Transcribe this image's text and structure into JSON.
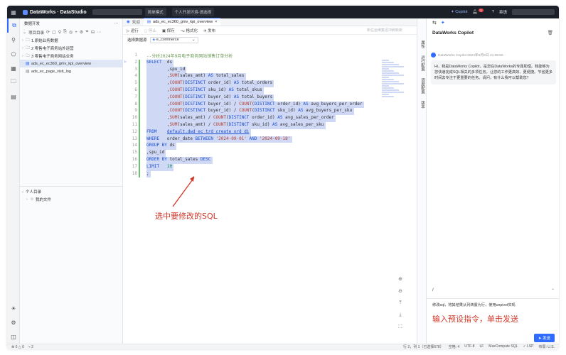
{
  "topbar": {
    "app_title": "DataWorks · DataStudio",
    "mode_pill": "简单模式",
    "env_label": "个人开发环境-请选择",
    "copilot_label": "Copilot",
    "notif_count": "1",
    "user_label": "英语"
  },
  "explorer": {
    "header": "数据开发",
    "section_title": "项目目录",
    "folders": [
      {
        "label": "1.原始业务数据"
      },
      {
        "label": "2 零售电子商务站外运营"
      },
      {
        "label": "3 零售电子商务网站业务"
      }
    ],
    "files": [
      {
        "label": "ads_ec_ec360_gmv_kpi_overview",
        "selected": true
      },
      {
        "label": "ads_ec_page_visit_log",
        "selected": false
      }
    ],
    "personal_title": "个人目录",
    "personal_folder": "我的文件"
  },
  "tabs": [
    {
      "label": "欢迎",
      "active": false
    },
    {
      "label": "ads_ec_ec360_gmv_kpi_overview",
      "active": true
    }
  ],
  "actions": {
    "run": "运行",
    "stop": "停止",
    "save": "保存",
    "format": "格式化",
    "publish": "发布",
    "right_hint": "新任运维集逗冲刷新新"
  },
  "datasource": {
    "label": "选择数据源",
    "value": "e_commerce"
  },
  "code_lines": [
    {
      "n": "1",
      "html": "<span class='cm'>--分析2024年9月电子商务网站销售订单分析</span>"
    },
    {
      "n": "2",
      "html": "<span class='kw'>SELECT</span>  ds"
    },
    {
      "n": "3",
      "html": "        ,spu_id"
    },
    {
      "n": "4",
      "html": "        ,<span class='fn'>SUM</span>(sales_amt) <span class='kw'>AS</span> total_sales"
    },
    {
      "n": "5",
      "html": "        ,<span class='fn'>COUNT</span>(<span class='kw'>DISTINCT</span> order_id) <span class='kw'>AS</span> total_orders"
    },
    {
      "n": "6",
      "html": "        ,<span class='fn'>COUNT</span>(<span class='kw'>DISTINCT</span> sku_id) <span class='kw'>AS</span> total_skus"
    },
    {
      "n": "7",
      "html": "        ,<span class='fn'>COUNT</span>(<span class='kw'>DISTINCT</span> buyer_id) <span class='kw'>AS</span> total_buyers"
    },
    {
      "n": "8",
      "html": "        ,<span class='fn'>COUNT</span>(<span class='kw'>DISTINCT</span> buyer_id) / <span class='fn'>COUNT</span>(<span class='kw'>DISTINCT</span> order_id) <span class='kw'>AS</span> avg_buyers_per_order"
    },
    {
      "n": "9",
      "html": "        ,<span class='fn'>COUNT</span>(<span class='kw'>DISTINCT</span> buyer_id) / <span class='fn'>COUNT</span>(<span class='kw'>DISTINCT</span> sku_id) <span class='kw'>AS</span> avg_buyers_per_sku"
    },
    {
      "n": "10",
      "html": "        ,<span class='fn'>SUM</span>(sales_amt) / <span class='fn'>COUNT</span>(<span class='kw'>DISTINCT</span> order_id) <span class='kw'>AS</span> avg_sales_per_order"
    },
    {
      "n": "11",
      "html": "        ,<span class='fn'>SUM</span>(sales_amt) / <span class='fn'>COUNT</span>(<span class='kw'>DISTINCT</span> sku_id) <span class='kw'>AS</span> avg_sales_per_sku"
    },
    {
      "n": "12",
      "html": "<span class='kw'>FROM</span>    <span class='tbl'>default.dwd_ec_trd_create_ord_di</span>"
    },
    {
      "n": "13",
      "html": "<span class='kw'>WHERE</span>   order_date <span class='kw'>BETWEEN</span> <span class='str'>'2024-09-01'</span> <span class='kw'>AND</span> <span class='str'>'2024-09-18'</span>"
    },
    {
      "n": "14",
      "html": "<span class='kw'>GROUP BY</span> ds"
    },
    {
      "n": "15",
      "html": ",spu_id"
    },
    {
      "n": "16",
      "html": "<span class='kw'>ORDER BY</span> total_sales <span class='kw'>DESC</span>"
    },
    {
      "n": "17",
      "html": "<span class='kw'>LIMIT</span>   <span class='num'>10</span>"
    },
    {
      "n": "18",
      "html": ";"
    }
  ],
  "annotations": {
    "editor_note": "选中要修改的SQL",
    "copilot_note": "输入预设指令，单击发送"
  },
  "side_tabs": [
    "属性",
    "运行配置",
    "调度配置",
    "版本"
  ],
  "copilot": {
    "title": "DataWorks Copilot",
    "sender_meta": "DataWorks Copilot  2024年9月6日 21:08:55",
    "greeting": "Hi，我是DataWorks Copilot，是您在DataWorks的专属助理。我能够为您快速完成SQL相关的多项任务，让您的工作更高效、更便捷。节省更多时间去专注于更重要的任务。请问，有什么我可以帮助您？",
    "slash": "/",
    "prompt_text": "修改sql，将其结果从列转置为行，使用unpivot实现",
    "send_label": "发送"
  },
  "statusbar": {
    "errors": "0",
    "warnings": "0",
    "commits": "2",
    "position": "行 2，列 1（已选择678）",
    "spaces": "空格: 4",
    "encoding": "UTF-8",
    "eol": "LF",
    "language": "MaxCompute SQL",
    "lsp": "LSP",
    "layout": "布局: U.S."
  }
}
